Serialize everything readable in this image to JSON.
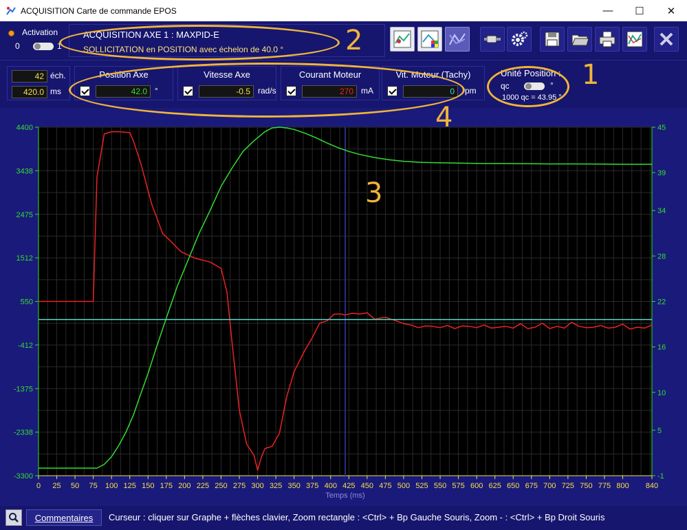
{
  "window": {
    "title": "ACQUISITION Carte de commande EPOS",
    "minimize": "—",
    "maximize": "☐",
    "close": "✕"
  },
  "activation": {
    "label": "Activation",
    "off": "0",
    "on": "1"
  },
  "acquisition": {
    "title": "ACQUISITION AXE 1 : MAXPID-E",
    "subtitle": "SOLLICITATION en POSITION avec échelon de 40.0 °"
  },
  "toolbar_icons": [
    "graph-settings-icon",
    "color-palette-icon",
    "graph-overlay-icon",
    "motor-icon",
    "gear-icon",
    "save-icon",
    "open-folder-icon",
    "print-icon",
    "export-chart-icon",
    "close-icon"
  ],
  "samples": {
    "count": "42",
    "count_unit": "éch.",
    "time": "420.0",
    "time_unit": "ms"
  },
  "channels": [
    {
      "name": "Position Axe",
      "value": "42.0",
      "unit": "°",
      "color": "#33dd33"
    },
    {
      "name": "Vitesse Axe",
      "value": "-0.5",
      "unit": "rad/s",
      "color": "#f4e04a"
    },
    {
      "name": "Courant Moteur",
      "value": "270",
      "unit": "mA",
      "color": "#ee2222"
    },
    {
      "name": "Vit. Moteur (Tachy)",
      "value": "0",
      "unit": "rpm",
      "color": "#33dddd"
    }
  ],
  "unite_position": {
    "title": "Unité Position :",
    "left": "qc",
    "right": "°",
    "conversion": "1000 qc = 43.95 °"
  },
  "annotations": [
    "1",
    "2",
    "3",
    "4"
  ],
  "chart_data": {
    "type": "line",
    "xlabel": "Temps (ms)",
    "x_ticks": [
      0,
      25,
      50,
      75,
      100,
      125,
      150,
      175,
      200,
      225,
      250,
      275,
      300,
      325,
      350,
      375,
      400,
      425,
      450,
      475,
      500,
      525,
      550,
      575,
      600,
      625,
      650,
      675,
      700,
      725,
      750,
      775,
      800,
      840
    ],
    "y_left_ticks": [
      4400,
      3438,
      2475,
      1512,
      550,
      -412,
      -1375,
      -2338,
      -3300
    ],
    "y_right_ticks": [
      45,
      39,
      34,
      28,
      22,
      16,
      10,
      5,
      -1
    ],
    "cursor_x": 420,
    "series": [
      {
        "color": "#ee2222",
        "axis": "left",
        "x": [
          0,
          70,
          75,
          80,
          90,
          100,
          110,
          125,
          130,
          140,
          155,
          170,
          180,
          195,
          215,
          235,
          250,
          258,
          265,
          275,
          285,
          295,
          300,
          305,
          310,
          320,
          330,
          340,
          350,
          365,
          375,
          385,
          395,
          405,
          415,
          420,
          430,
          440,
          450,
          460,
          475,
          490,
          500,
          510,
          520,
          530,
          540,
          550,
          560,
          570,
          580,
          590,
          600,
          610,
          620,
          630,
          640,
          650,
          660,
          670,
          680,
          690,
          700,
          710,
          720,
          730,
          740,
          750,
          760,
          770,
          780,
          790,
          800,
          810,
          820,
          830,
          840
        ],
        "y": [
          550,
          550,
          550,
          3300,
          4250,
          4300,
          4300,
          4280,
          4100,
          3600,
          2700,
          2050,
          1900,
          1650,
          1500,
          1420,
          1280,
          760,
          -350,
          -1850,
          -2600,
          -2850,
          -3180,
          -2900,
          -2700,
          -2650,
          -2360,
          -1550,
          -1000,
          -520,
          -250,
          70,
          120,
          270,
          270,
          250,
          290,
          270,
          300,
          160,
          200,
          120,
          60,
          30,
          -30,
          10,
          0,
          -30,
          20,
          -50,
          10,
          0,
          -30,
          30,
          -40,
          -20,
          0,
          -40,
          60,
          -50,
          -20,
          70,
          -50,
          0,
          -40,
          90,
          0,
          -30,
          -20,
          20,
          -40,
          -20,
          50,
          -60,
          -20,
          -40,
          30
        ]
      },
      {
        "color": "#33dd33",
        "axis": "right",
        "x": [
          0,
          70,
          80,
          90,
          100,
          110,
          120,
          130,
          140,
          150,
          160,
          175,
          190,
          205,
          220,
          235,
          250,
          265,
          280,
          295,
          310,
          320,
          330,
          340,
          350,
          365,
          380,
          395,
          410,
          425,
          440,
          460,
          480,
          500,
          525,
          550,
          580,
          610,
          640,
          670,
          700,
          740,
          780,
          820,
          840
        ],
        "y": [
          0,
          0,
          0,
          0.5,
          1.5,
          3,
          4.8,
          7,
          9.8,
          12.5,
          15.5,
          19.8,
          24,
          27.5,
          31,
          34,
          37.2,
          39.6,
          41.8,
          43.2,
          44.4,
          44.9,
          45,
          44.9,
          44.7,
          44.2,
          43.6,
          42.9,
          42.3,
          41.8,
          41.4,
          41,
          40.7,
          40.5,
          40.35,
          40.3,
          40.25,
          40.2,
          40.2,
          40.18,
          40.15,
          40.15,
          40.12,
          40.1,
          40.1
        ]
      },
      {
        "color": "#4fd8c8",
        "axis": "left",
        "x": [
          0,
          840
        ],
        "y": [
          150,
          150
        ]
      }
    ]
  },
  "bottom": {
    "comment_label": "Commentaires",
    "hint": "Curseur : cliquer sur Graphe + flèches clavier, Zoom rectangle : <Ctrl> + Bp Gauche Souris, Zoom - : <Ctrl> + Bp Droit Souris"
  }
}
